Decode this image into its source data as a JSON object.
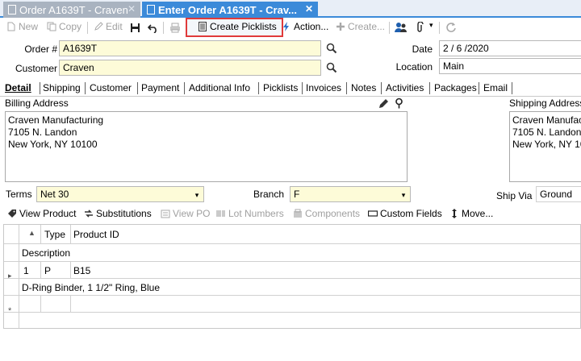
{
  "tabs": [
    {
      "label": "Order A1639T - Craven",
      "close": "✕"
    },
    {
      "label": "Enter Order A1639T - Crav...",
      "close": "✕"
    }
  ],
  "toolbar": {
    "new": "New",
    "copy": "Copy",
    "edit": "Edit",
    "create_picklists": "Create Picklists",
    "actions": "Action...",
    "create": "Create...",
    "dropdown_arrow": "▾"
  },
  "form": {
    "order_label": "Order #",
    "order_value": "A1639T",
    "customer_label": "Customer",
    "customer_value": "Craven",
    "date_label": "Date",
    "date_value": "2 / 6 /2020",
    "location_label": "Location",
    "location_value": "Main"
  },
  "subtabs": [
    "Detail",
    "Shipping",
    "Customer",
    "Payment",
    "Additional Info",
    "Picklists",
    "Invoices",
    "Notes",
    "Activities",
    "Packages",
    "Email"
  ],
  "billing": {
    "label": "Billing Address",
    "lines": [
      "Craven Manufacturing",
      "7105 N. Landon",
      "New York, NY 10100"
    ]
  },
  "shipping": {
    "label": "Shipping Address",
    "lines": [
      "Craven Manufac",
      "7105 N. Landon",
      "New York, NY 10"
    ]
  },
  "terms": {
    "label": "Terms",
    "value": "Net 30"
  },
  "branch": {
    "label": "Branch",
    "value": "F"
  },
  "shipvia": {
    "label": "Ship Via",
    "value": "Ground"
  },
  "line_actions": {
    "view_product": "View Product",
    "substitutions": "Substitutions",
    "view_po": "View PO",
    "lot_numbers": "Lot Numbers",
    "components": "Components",
    "custom_fields": "Custom Fields",
    "move": "Move..."
  },
  "grid": {
    "columns": [
      "Type",
      "Product ID"
    ],
    "description_header": "Description",
    "rows": [
      {
        "line": "1",
        "type": "P",
        "product_id": "B15",
        "description": "D-Ring Binder, 1 1/2\" Ring, Blue"
      }
    ],
    "new_row_marker": "*",
    "sort_marker": "▲",
    "current_row_marker": "▸"
  },
  "colors": {
    "accent": "#3b8ad9",
    "highlight": "#e03a3a",
    "field_yellow": "#fdfbd8"
  }
}
